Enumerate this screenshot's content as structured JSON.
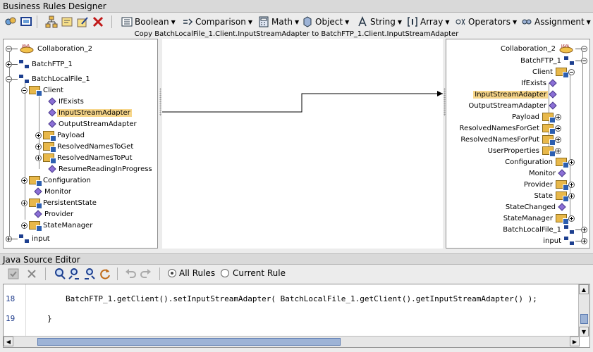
{
  "window": {
    "title": "Business Rules Designer"
  },
  "toolbar": {
    "menus": [
      "Boolean",
      "Comparison",
      "Math",
      "Object",
      "String",
      "Array",
      "Operators",
      "Assignment"
    ]
  },
  "mapping_label": "Copy BatchLocalFile_1.Client.InputStreamAdapter to BatchFTP_1.Client.InputStreamAdapter",
  "left_tree": {
    "collab": "Collaboration_2",
    "batchftp": "BatchFTP_1",
    "batchlocal": "BatchLocalFile_1",
    "client": "Client",
    "ifexists": "IfExists",
    "inputstream": "InputStreamAdapter",
    "outputstream": "OutputStreamAdapter",
    "payload": "Payload",
    "resolvedget": "ResolvedNamesToGet",
    "resolvedput": "ResolvedNamesToPut",
    "resume": "ResumeReadingInProgress",
    "configuration": "Configuration",
    "monitor": "Monitor",
    "persistent": "PersistentState",
    "provider": "Provider",
    "statemanager": "StateManager",
    "input": "input"
  },
  "right_tree": {
    "collab": "Collaboration_2",
    "batchftp": "BatchFTP_1",
    "client": "Client",
    "ifexists": "IfExists",
    "inputstream": "InputStreamAdapter",
    "outputstream": "OutputStreamAdapter",
    "payload": "Payload",
    "resolvedget": "ResolvedNamesForGet",
    "resolvedput": "ResolvedNamesForPut",
    "userprops": "UserProperties",
    "configuration": "Configuration",
    "monitor": "Monitor",
    "provider": "Provider",
    "state": "State",
    "statechanged": "StateChanged",
    "statemanager": "StateManager",
    "batchlocal": "BatchLocalFile_1",
    "input": "input"
  },
  "editor": {
    "title": "Java Source Editor",
    "radio_all": "All Rules",
    "radio_current": "Current Rule",
    "lines": [
      {
        "no": "18",
        "code": "BatchFTP_1.getClient().setInputStreamAdapter( BatchLocalFile_1.getClient().getInputStreamAdapter() );"
      },
      {
        "no": "19",
        "code": "}"
      }
    ]
  }
}
